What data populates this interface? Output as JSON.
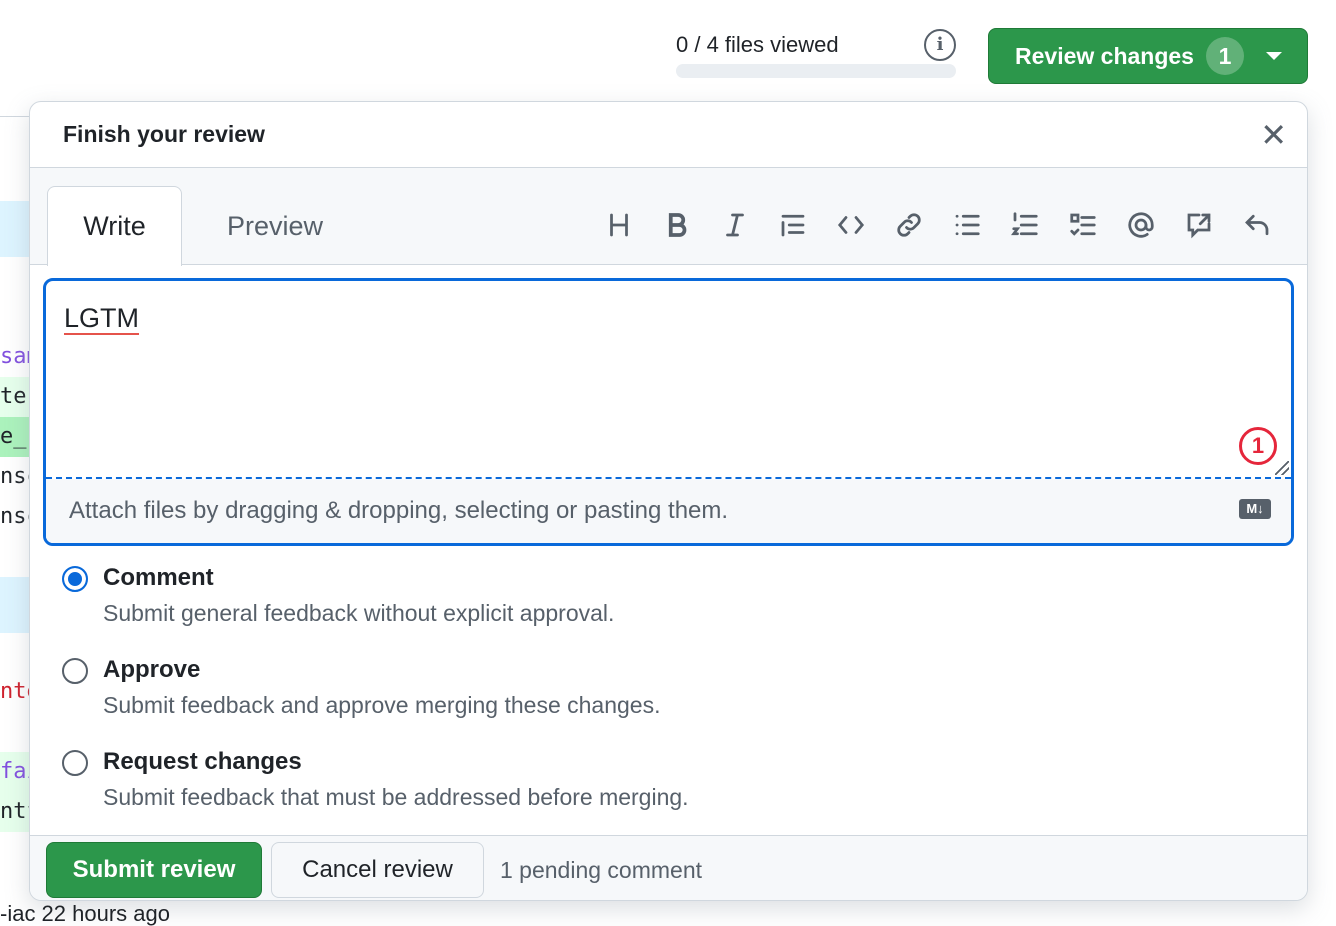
{
  "background": {
    "code_fragments": [
      "sam",
      "ter",
      "e_r",
      "nsc",
      "nsc",
      "nte",
      "fai",
      "ntf"
    ],
    "footer_fragment": "-iac 22 hours ago"
  },
  "progress": {
    "label": "0 / 4 files viewed",
    "viewed": 0,
    "total": 4
  },
  "header": {
    "review_button": "Review changes",
    "review_count": "1",
    "info_icon": "info-icon"
  },
  "dialog": {
    "title": "Finish your review",
    "tabs": [
      {
        "label": "Write",
        "active": true
      },
      {
        "label": "Preview",
        "active": false
      }
    ],
    "toolbar": [
      "heading",
      "bold",
      "italic",
      "quote",
      "code",
      "link",
      "unordered-list",
      "ordered-list",
      "task-list",
      "mention",
      "reference",
      "undo"
    ],
    "editor": {
      "value": "LGTM",
      "annotation": "1",
      "attach_hint": "Attach files by dragging & dropping, selecting or pasting them.",
      "markdown_badge": "M↓"
    },
    "options": [
      {
        "label": "Comment",
        "description": "Submit general feedback without explicit approval.",
        "checked": true
      },
      {
        "label": "Approve",
        "description": "Submit feedback and approve merging these changes.",
        "checked": false
      },
      {
        "label": "Request changes",
        "description": "Submit feedback that must be addressed before merging.",
        "checked": false
      }
    ],
    "submit": "Submit review",
    "cancel": "Cancel review",
    "pending": "1 pending comment"
  },
  "colors": {
    "accent": "#0969da",
    "primary": "#2c974b",
    "annotation": "#e5263b"
  }
}
